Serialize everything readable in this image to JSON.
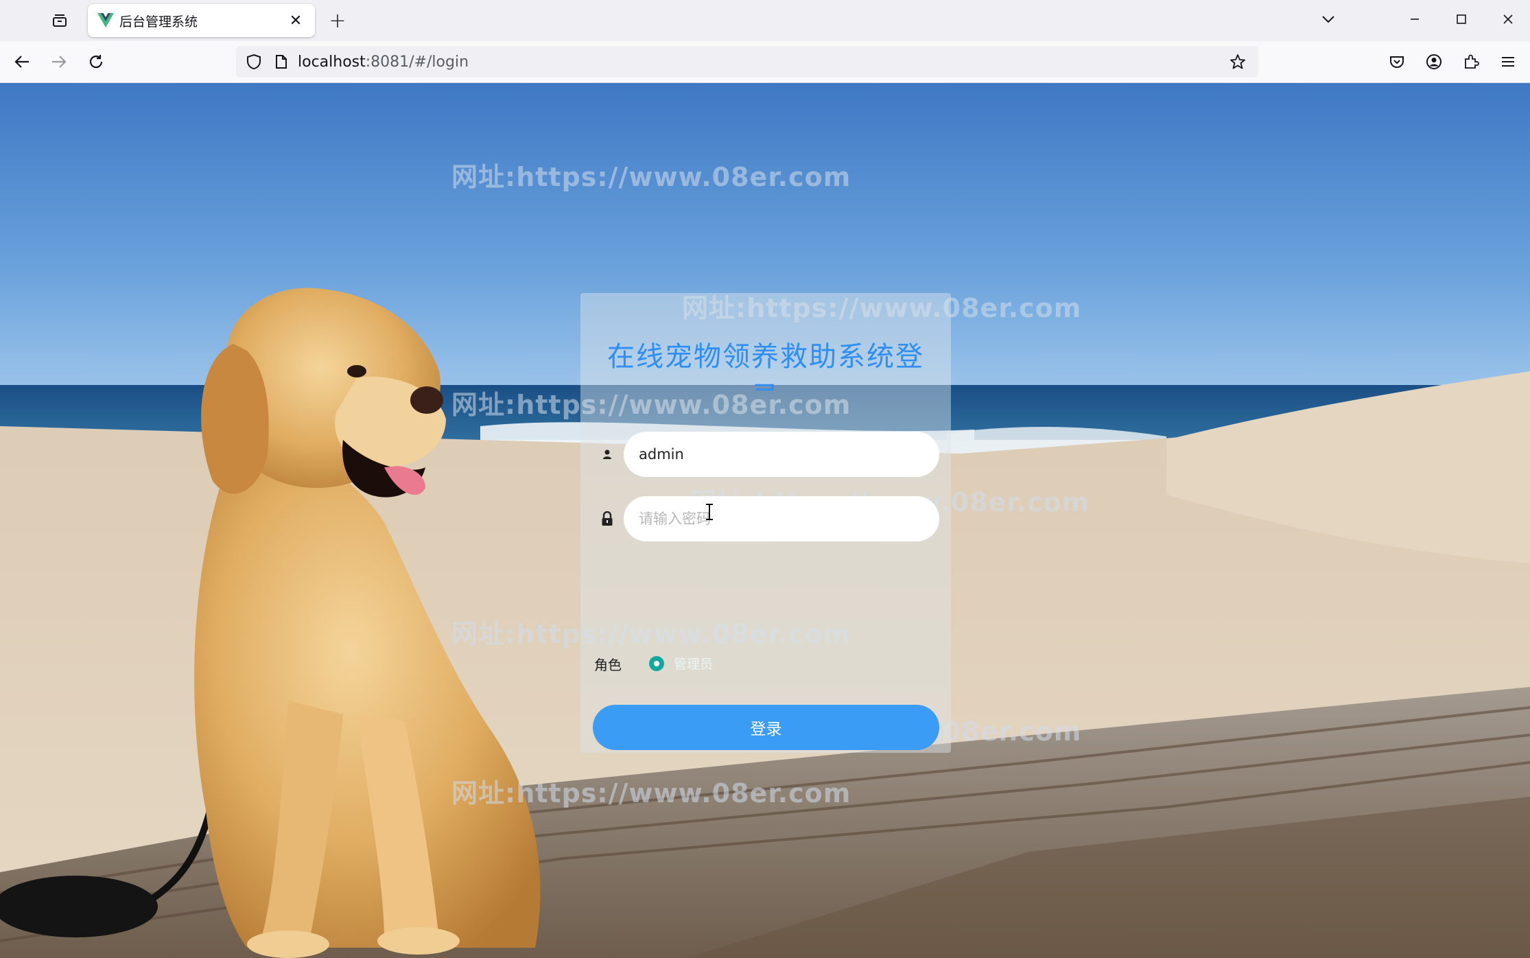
{
  "browser": {
    "tab_title": "后台管理系统",
    "tab_close_glyph": "✕",
    "new_tab_glyph": "+",
    "url_host": "localhost",
    "url_rest": ":8081/#/login"
  },
  "watermark": {
    "text": "网址:https://www.08er.com"
  },
  "login": {
    "title": "在线宠物领养救助系统登录",
    "username_value": "admin",
    "password_placeholder": "请输入密码",
    "role_label": "角色",
    "role_option": "管理员",
    "submit_label": "登录"
  },
  "icons": {
    "tabs": "tab-list-icon",
    "back": "back-arrow-icon",
    "forward": "forward-arrow-icon",
    "reload": "reload-icon",
    "shield": "tracking-shield-icon",
    "page": "page-icon",
    "star": "bookmark-star-icon",
    "pocket": "pocket-icon",
    "account": "account-icon",
    "extensions": "extensions-icon",
    "menu": "hamburger-menu-icon",
    "user": "user-icon",
    "lock": "lock-icon"
  },
  "colors": {
    "accent": "#3a9cf5",
    "title": "#2f8ef3",
    "radio": "#13a89e"
  }
}
